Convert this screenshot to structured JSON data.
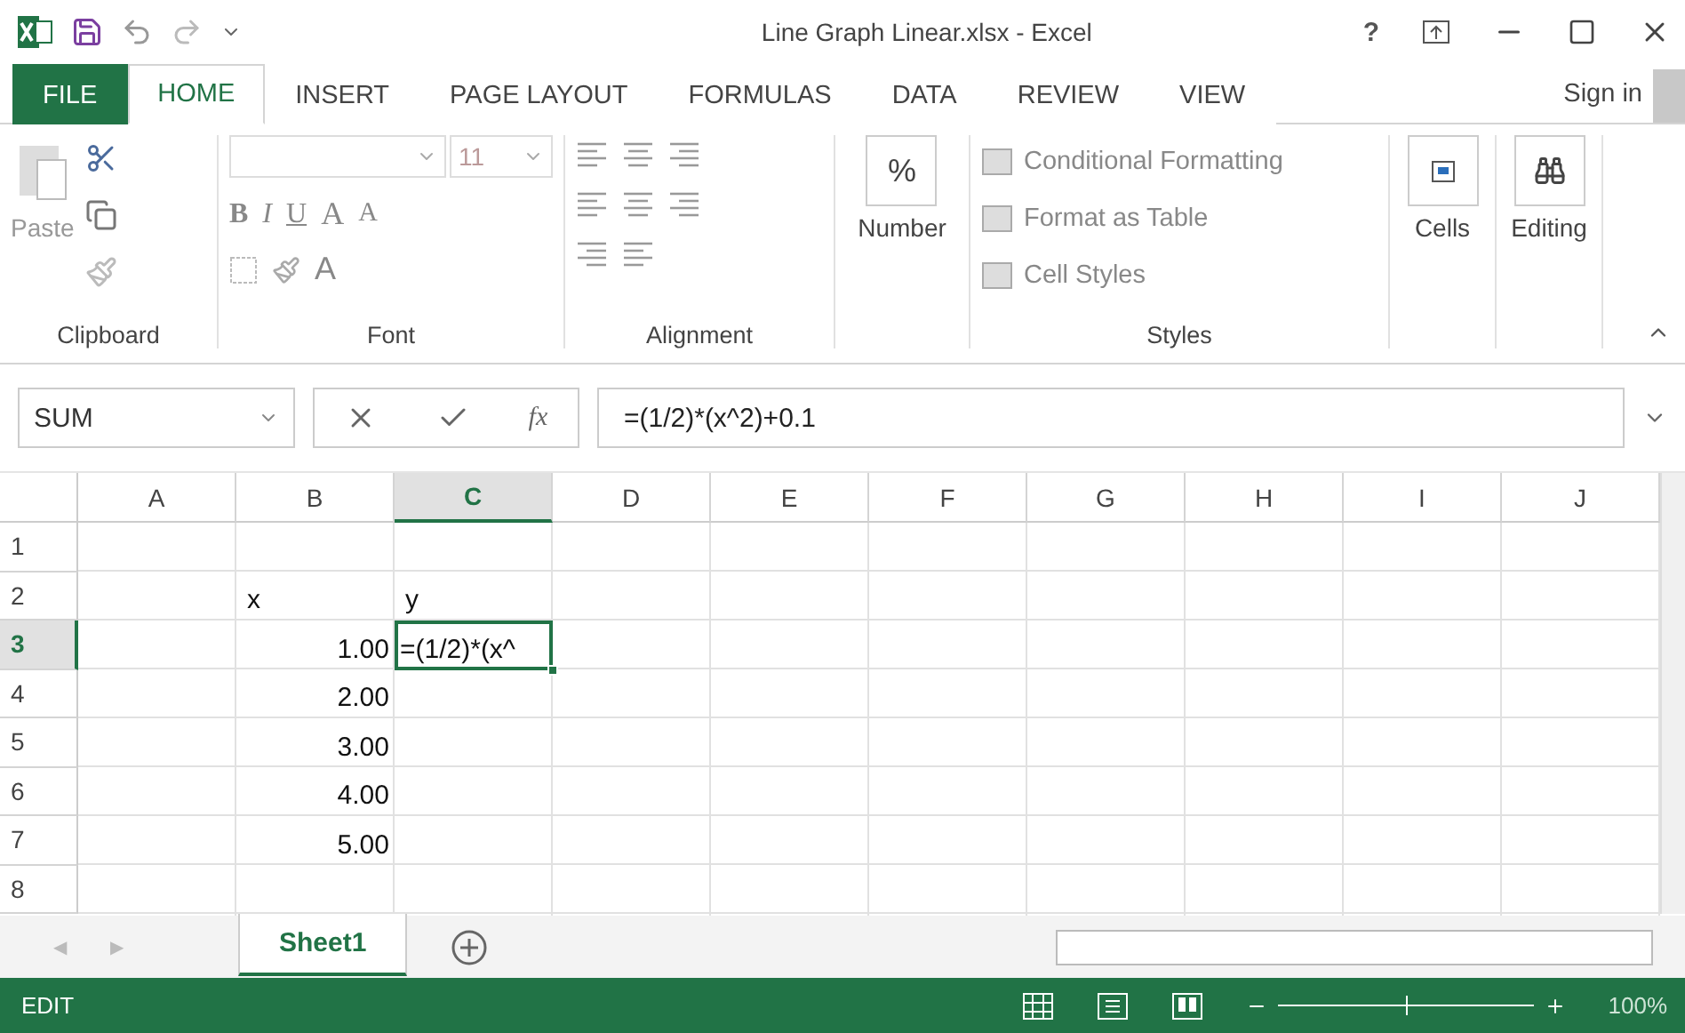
{
  "title_bar": {
    "title": "Line Graph Linear.xlsx - Excel",
    "help": "?"
  },
  "tabs": [
    {
      "label": "FILE",
      "kind": "file",
      "selected": false
    },
    {
      "label": "HOME",
      "kind": "tab",
      "selected": true
    },
    {
      "label": "INSERT",
      "kind": "tab",
      "selected": false
    },
    {
      "label": "PAGE LAYOUT",
      "kind": "tab",
      "selected": false
    },
    {
      "label": "FORMULAS",
      "kind": "tab",
      "selected": false
    },
    {
      "label": "DATA",
      "kind": "tab",
      "selected": false
    },
    {
      "label": "REVIEW",
      "kind": "tab",
      "selected": false
    },
    {
      "label": "VIEW",
      "kind": "tab",
      "selected": false
    }
  ],
  "sign_in": "Sign in",
  "ribbon": {
    "clipboard": {
      "label": "Clipboard",
      "paste": "Paste"
    },
    "font": {
      "label": "Font",
      "size": "11",
      "format_buttons": [
        "B",
        "I",
        "U"
      ],
      "size_buttons": [
        "A",
        "A"
      ],
      "color_button": "A"
    },
    "alignment": {
      "label": "Alignment"
    },
    "number": {
      "label": "Number",
      "symbol": "%"
    },
    "styles": {
      "label": "Styles",
      "items": [
        "Conditional Formatting",
        "Format as Table",
        "Cell Styles"
      ]
    },
    "cells": {
      "label": "Cells"
    },
    "editing": {
      "label": "Editing"
    }
  },
  "formula_bar": {
    "name_box": "SUM",
    "fx": "fx",
    "formula": "=(1/2)*(x^2)+0.1"
  },
  "columns": [
    {
      "label": "A",
      "selected": false
    },
    {
      "label": "B",
      "selected": false
    },
    {
      "label": "C",
      "selected": true
    },
    {
      "label": "D",
      "selected": false
    },
    {
      "label": "E",
      "selected": false
    },
    {
      "label": "F",
      "selected": false
    },
    {
      "label": "G",
      "selected": false
    },
    {
      "label": "H",
      "selected": false
    },
    {
      "label": "I",
      "selected": false
    },
    {
      "label": "J",
      "selected": false
    }
  ],
  "rows": [
    {
      "label": "1",
      "selected": false,
      "cells": [
        null,
        null,
        null,
        null,
        null,
        null,
        null,
        null,
        null,
        null
      ]
    },
    {
      "label": "2",
      "selected": false,
      "cells": [
        null,
        {
          "text": "x",
          "kind": "text"
        },
        {
          "text": "y",
          "kind": "text"
        },
        null,
        null,
        null,
        null,
        null,
        null,
        null
      ]
    },
    {
      "label": "3",
      "selected": true,
      "cells": [
        null,
        {
          "text": "1.00",
          "kind": "number"
        },
        {
          "text": "=(1/2)*(x^",
          "kind": "text"
        },
        null,
        null,
        null,
        null,
        null,
        null,
        null
      ]
    },
    {
      "label": "4",
      "selected": false,
      "cells": [
        null,
        {
          "text": "2.00",
          "kind": "number"
        },
        null,
        null,
        null,
        null,
        null,
        null,
        null,
        null
      ]
    },
    {
      "label": "5",
      "selected": false,
      "cells": [
        null,
        {
          "text": "3.00",
          "kind": "number"
        },
        null,
        null,
        null,
        null,
        null,
        null,
        null,
        null
      ]
    },
    {
      "label": "6",
      "selected": false,
      "cells": [
        null,
        {
          "text": "4.00",
          "kind": "number"
        },
        null,
        null,
        null,
        null,
        null,
        null,
        null,
        null
      ]
    },
    {
      "label": "7",
      "selected": false,
      "cells": [
        null,
        {
          "text": "5.00",
          "kind": "number"
        },
        null,
        null,
        null,
        null,
        null,
        null,
        null,
        null
      ]
    },
    {
      "label": "8",
      "selected": false,
      "cells": [
        null,
        null,
        null,
        null,
        null,
        null,
        null,
        null,
        null,
        null
      ]
    }
  ],
  "sheet_nav": [
    "◀",
    "▶"
  ],
  "sheets": [
    {
      "label": "Sheet1",
      "selected": true
    }
  ],
  "status_bar": {
    "mode": "EDIT",
    "zoom": {
      "level": 0.5,
      "reading": "100%"
    }
  }
}
